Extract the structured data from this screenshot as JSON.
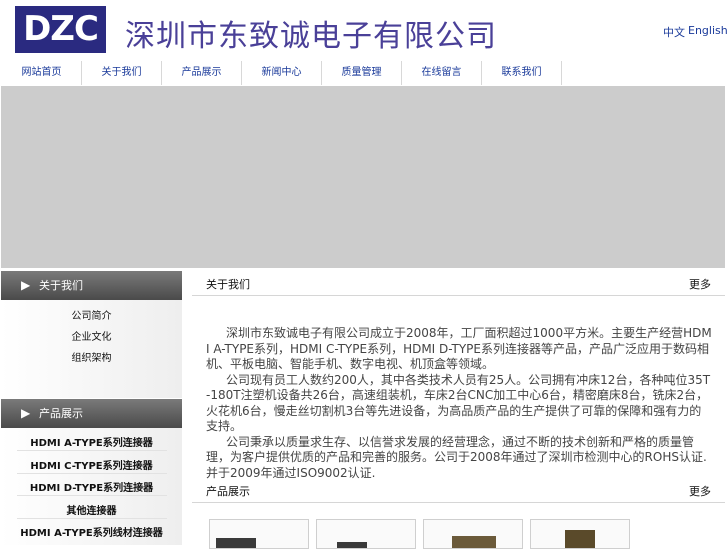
{
  "header": {
    "logo_text": "DZC",
    "company_name": "深圳市东致诚电子有限公司",
    "lang_cn": "中文",
    "lang_en": "English"
  },
  "nav": {
    "items": [
      "网站首页",
      "关于我们",
      "产品展示",
      "新闻中心",
      "质量管理",
      "在线留言",
      "联系我们"
    ]
  },
  "sidebar": {
    "about_title": "关于我们",
    "about_items": [
      "公司简介",
      "企业文化",
      "组织架构"
    ],
    "products_title": "产品展示",
    "product_items": [
      "HDMI A-TYPE系列连接器",
      "HDMI C-TYPE系列连接器",
      "HDMI D-TYPE系列连接器",
      "其他连接器",
      "HDMI A-TYPE系列线材连接器"
    ]
  },
  "main": {
    "about_title": "关于我们",
    "about_more": "更多",
    "intro_paragraphs": [
      "深圳市东致诚电子有限公司成立于2008年，工厂面积超过1000平方米。主要生产经营HDMI A-TYPE系列，HDMI C-TYPE系列，HDMI D-TYPE系列连接器等产品，产品广泛应用于数码相机、平板电脑、智能手机、数字电视、机顶盒等领域。",
      "公司现有员工人数约200人，其中各类技术人员有25人。公司拥有冲床12台，各种吨位35T-180T注塑机设备共26台，高速组装机，车床2台CNC加工中心6台，精密磨床8台，铣床2台，火花机6台，慢走丝切割机3台等先进设备，为高品质产品的生产提供了可靠的保障和强有力的支持。",
      "公司秉承以质量求生存、以信誉求发展的经营理念，通过不断的技术创新和严格的质量管理，为客户提供优质的产品和完善的服务。公司于2008年通过了深圳市检测中心的ROHS认证.并于2009年通过ISO9002认证."
    ],
    "products_title": "产品展示",
    "products_more": "更多"
  },
  "colors": {
    "brand": "#2a2a80",
    "company_text": "#4a4098",
    "nav_text": "#1a3a9a",
    "banner": "#cccccc",
    "sidebar_head": "#5a5a5a"
  }
}
